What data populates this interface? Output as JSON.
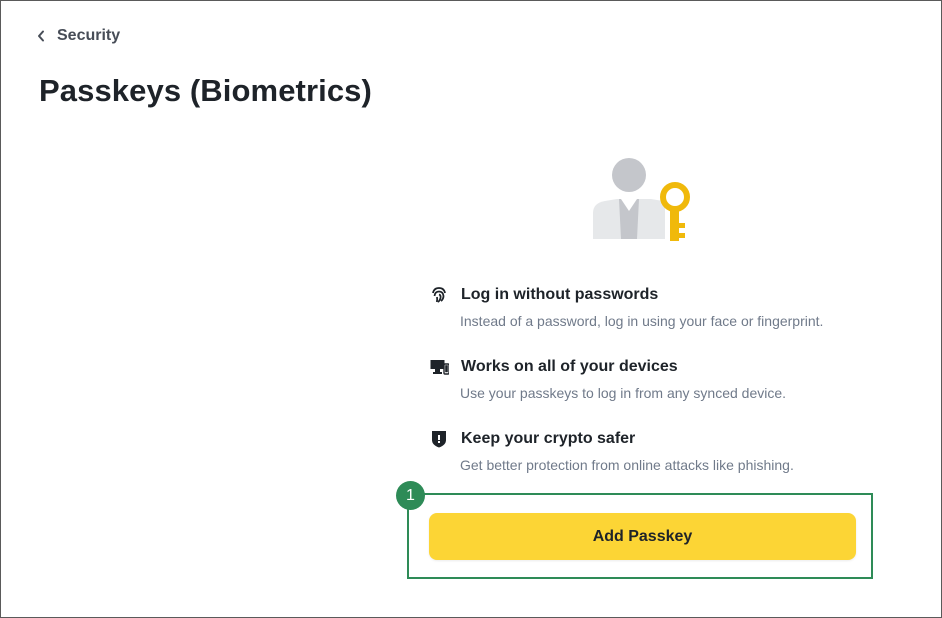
{
  "breadcrumb": {
    "label": "Security",
    "icon": "chevron-left-icon"
  },
  "page": {
    "title": "Passkeys (Biometrics)"
  },
  "illustration": {
    "icon": "user-key-illustration",
    "colors": {
      "person": "#c4c6cb",
      "body": "#e6e8ea",
      "key": "#f0b90b"
    }
  },
  "features": [
    {
      "icon": "fingerprint-icon",
      "title": "Log in without passwords",
      "description": "Instead of a password, log in using your face or fingerprint."
    },
    {
      "icon": "devices-icon",
      "title": "Works on all of your devices",
      "description": "Use your passkeys to log in from any synced device."
    },
    {
      "icon": "shield-icon",
      "title": "Keep your crypto safer",
      "description": "Get better protection from online attacks like phishing."
    }
  ],
  "annotation": {
    "step": "1",
    "color": "#2e8b57"
  },
  "actions": {
    "add_passkey_label": "Add Passkey",
    "button_color": "#fcd535"
  }
}
